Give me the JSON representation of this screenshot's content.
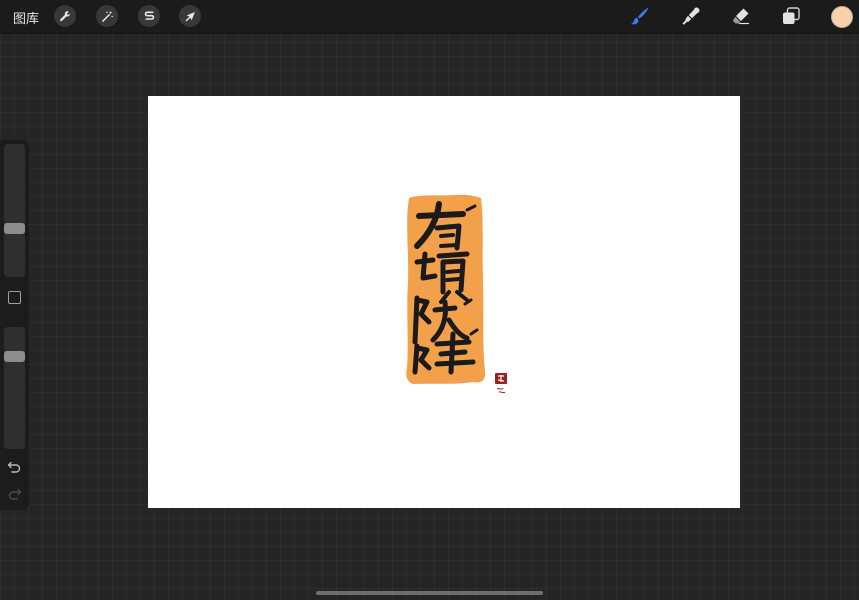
{
  "toolbar": {
    "gallery_label": "图库",
    "left_tools": [
      "wrench-icon",
      "magic-wand-icon",
      "selection-icon",
      "transform-arrow-icon"
    ],
    "right_tools": [
      "brush-icon",
      "smudge-icon",
      "eraser-icon",
      "layers-icon"
    ],
    "active_tool": "brush",
    "current_color": "#f6d1ac",
    "accent_color": "#3b79f0"
  },
  "sidebar": {
    "brush_size_level": 0.35,
    "opacity_level": 0.78,
    "controls": [
      "brush-size-slider",
      "modify-button",
      "opacity-slider",
      "undo-icon",
      "redo-icon"
    ]
  },
  "artwork": {
    "label_color": "#f2a14a",
    "ink_color": "#1a1a1a",
    "seal_color": "#a11f23"
  }
}
